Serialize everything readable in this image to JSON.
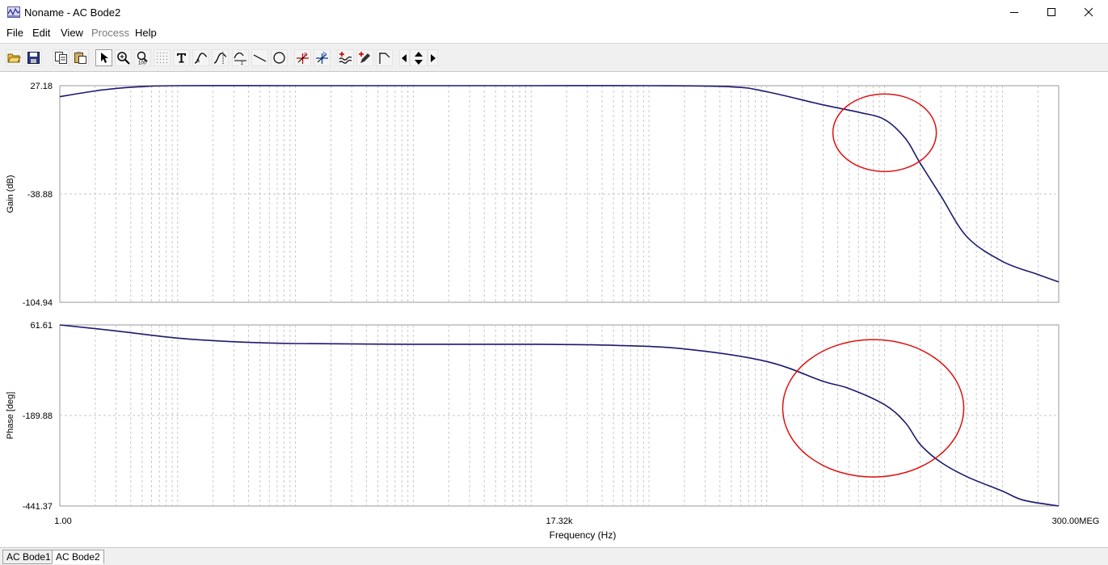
{
  "window": {
    "title": "Noname - AC Bode2",
    "icon": "bode-plot-app-icon",
    "controls": [
      "minimize-icon",
      "maximize-icon",
      "close-icon"
    ]
  },
  "menu": {
    "items": [
      {
        "label": "File",
        "enabled": true
      },
      {
        "label": "Edit",
        "enabled": true
      },
      {
        "label": "View",
        "enabled": true
      },
      {
        "label": "Process",
        "enabled": false
      },
      {
        "label": "Help",
        "enabled": true
      }
    ]
  },
  "toolbar": {
    "buttons": [
      "open-folder-icon",
      "save-icon",
      "copy-icon",
      "paste-icon",
      "select-arrow-icon",
      "zoom-in-icon",
      "zoom-100-icon",
      "grid-icon",
      "text-tool-icon",
      "curve-label-icon",
      "curve-label-alt-icon",
      "baseline-icon",
      "line-tool-icon",
      "circle-tool-icon",
      "cursor-a-icon",
      "cursor-b-icon",
      "add-curve-icon",
      "marker-pen-icon",
      "flag-icon",
      "scroll-left-icon",
      "scroll-up-down-icon",
      "scroll-right-icon"
    ],
    "pressed": "select-arrow-icon"
  },
  "chart_data": [
    {
      "type": "line",
      "ylabel": "Gain (dB)",
      "xlabel": "Frequency (Hz)",
      "x_scale": "log",
      "xlim": [
        1.0,
        300000000
      ],
      "ylim": [
        -104.94,
        27.18
      ],
      "y_tick_labels": [
        "27.18",
        "-38.88",
        "-104.94"
      ],
      "grid": true,
      "series": [
        {
          "color": "#1a1a6e",
          "x": [
            1,
            2,
            3,
            5,
            10,
            100,
            1000,
            10000,
            100000,
            500000,
            1000000,
            3000000,
            6000000,
            10000000,
            15000000,
            20000000,
            30000000,
            50000000,
            100000000,
            200000000,
            300000000
          ],
          "y": [
            20.5,
            24.0,
            25.5,
            26.6,
            27.18,
            27.18,
            27.18,
            27.18,
            27.18,
            26.5,
            23.5,
            15.5,
            11.0,
            6.5,
            -5.0,
            -20.0,
            -40.0,
            -65.0,
            -80.0,
            -88.0,
            -92.5
          ]
        }
      ],
      "annotations": [
        {
          "type": "ellipse",
          "color": "#dd1111",
          "center_x": 10000000,
          "center_y": -1.5
        }
      ]
    },
    {
      "type": "line",
      "ylabel": "Phase [deg]",
      "xlabel": "Frequency (Hz)",
      "x_scale": "log",
      "xlim": [
        1.0,
        300000000
      ],
      "ylim": [
        -441.37,
        61.61
      ],
      "y_tick_labels": [
        "61.61",
        "-189.88",
        "-441.37"
      ],
      "grid": true,
      "series": [
        {
          "color": "#1a1a6e",
          "x": [
            1,
            3,
            10,
            30,
            100,
            1000,
            10000,
            50000,
            200000,
            1000000,
            3000000,
            5000000,
            10000000,
            15000000,
            20000000,
            30000000,
            50000000,
            100000000,
            150000000,
            300000000
          ],
          "y": [
            61.61,
            45.0,
            25.0,
            15.0,
            10.0,
            8.0,
            8.0,
            5.0,
            -5.0,
            -40.0,
            -95.0,
            -115.0,
            -160.0,
            -210.0,
            -270.0,
            -320.0,
            -360.0,
            -400.0,
            -425.0,
            -441.37
          ]
        }
      ],
      "annotations": [
        {
          "type": "ellipse",
          "color": "#dd1111",
          "center_x": 8000000,
          "center_y": -170.0
        }
      ]
    }
  ],
  "axis": {
    "x_tick_labels": [
      "1.00",
      "17.32k",
      "300.00MEG"
    ],
    "x_tick_values": [
      1,
      17320,
      300000000
    ]
  },
  "sheets": {
    "tabs": [
      "AC Bode1",
      "AC Bode2"
    ],
    "active": "AC Bode2"
  }
}
